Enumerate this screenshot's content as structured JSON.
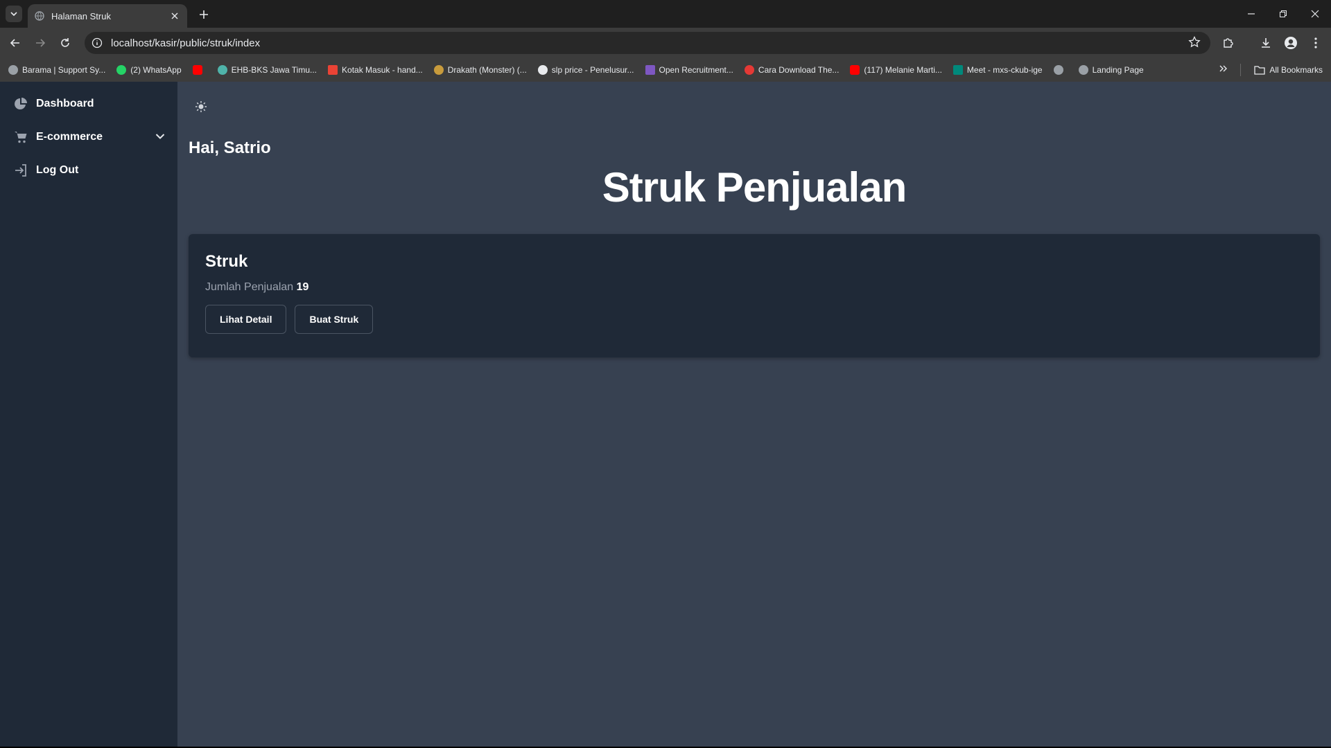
{
  "browser": {
    "tab_title": "Halaman Struk",
    "url": "localhost/kasir/public/struk/index",
    "bookmarks": [
      {
        "label": "Barama | Support Sy...",
        "color": "#9aa0a6"
      },
      {
        "label": "(2) WhatsApp",
        "color": "#25d366"
      },
      {
        "label": "",
        "color": "#ff0000"
      },
      {
        "label": "EHB-BKS Jawa Timu...",
        "color": "#4fb3a9"
      },
      {
        "label": "Kotak Masuk - hand...",
        "color": "#ea4335"
      },
      {
        "label": "Drakath (Monster) (...",
        "color": "#c89b3c"
      },
      {
        "label": "slp price - Penelusur...",
        "color": "#e8eaed"
      },
      {
        "label": "Open Recruitment...",
        "color": "#7e57c2"
      },
      {
        "label": "Cara Download The...",
        "color": "#e53935"
      },
      {
        "label": "(117) Melanie Marti...",
        "color": "#ff0000"
      },
      {
        "label": "Meet - mxs-ckub-ige",
        "color": "#00897b"
      },
      {
        "label": "",
        "color": "#9aa0a6"
      },
      {
        "label": "Landing Page",
        "color": "#9aa0a6"
      }
    ],
    "all_bookmarks_label": "All Bookmarks"
  },
  "sidebar": {
    "items": [
      {
        "label": "Dashboard",
        "icon": "pie-chart-icon"
      },
      {
        "label": "E-commerce",
        "icon": "cart-icon"
      },
      {
        "label": "Log Out",
        "icon": "logout-icon"
      }
    ]
  },
  "main": {
    "greeting": "Hai, Satrio",
    "title": "Struk Penjualan",
    "card": {
      "title": "Struk",
      "stat_label": "Jumlah Penjualan",
      "stat_value": "19",
      "detail_button": "Lihat Detail",
      "create_button": "Buat Struk"
    }
  },
  "colors": {
    "sidebar_bg": "#1f2937",
    "main_bg": "#374151",
    "card_bg": "#1f2937"
  }
}
